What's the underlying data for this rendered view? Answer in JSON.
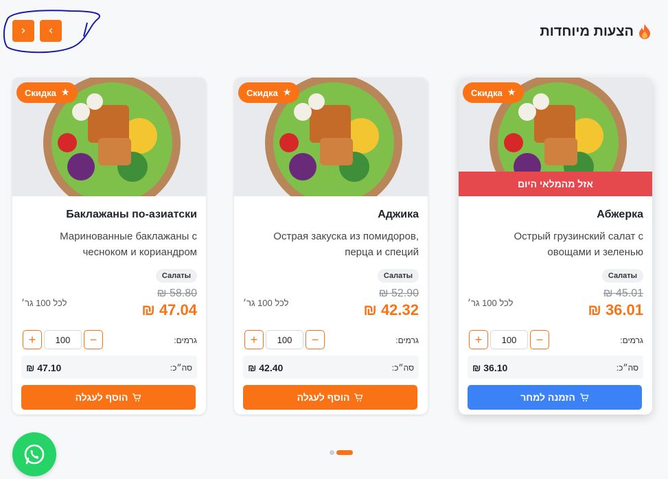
{
  "section": {
    "title": "הצעות מיוחדות",
    "icon": "fire-icon"
  },
  "nav": {
    "prev_label": "›",
    "next_label": "‹"
  },
  "colors": {
    "accent": "#f97316",
    "blue": "#3b82f6",
    "soldout": "#e5484d",
    "whatsapp": "#25d366"
  },
  "cards": [
    {
      "badge": "Скидка",
      "soldout": "אזל מהמלאי היום",
      "name": "Абжерка",
      "desc": "Острый грузинский салат с овощами и зеленью",
      "tag": "Салаты",
      "old_price": "₪ 45.01",
      "new_price": "₪ 36.01",
      "per_unit": "לכל 100 גר׳",
      "qty_label": "גרמים:",
      "qty_value": "100",
      "total_label": "סה״כ:",
      "total_value": "₪ 36.10",
      "cta": "הזמנה למחר"
    },
    {
      "badge": "Скидка",
      "name": "Аджика",
      "desc": "Острая закуска из помидоров, перца и специй",
      "tag": "Салаты",
      "old_price": "₪ 52.90",
      "new_price": "₪ 42.32",
      "per_unit": "לכל 100 גר׳",
      "qty_label": "גרמים:",
      "qty_value": "100",
      "total_label": "סה״כ:",
      "total_value": "₪ 42.40",
      "cta": "הוסף לעגלה"
    },
    {
      "badge": "Скидка",
      "name": "Баклажаны по-азиатски",
      "desc": "Маринованные баклажаны с чесноком и кориандром",
      "tag": "Салаты",
      "old_price": "₪ 58.80",
      "new_price": "₪ 47.04",
      "per_unit": "לכל 100 גר׳",
      "qty_label": "גרמים:",
      "qty_value": "100",
      "total_label": "סה״כ:",
      "total_value": "₪ 47.10",
      "cta": "הוסף לעגלה"
    }
  ],
  "pagination": {
    "count": 2,
    "active": 1
  }
}
